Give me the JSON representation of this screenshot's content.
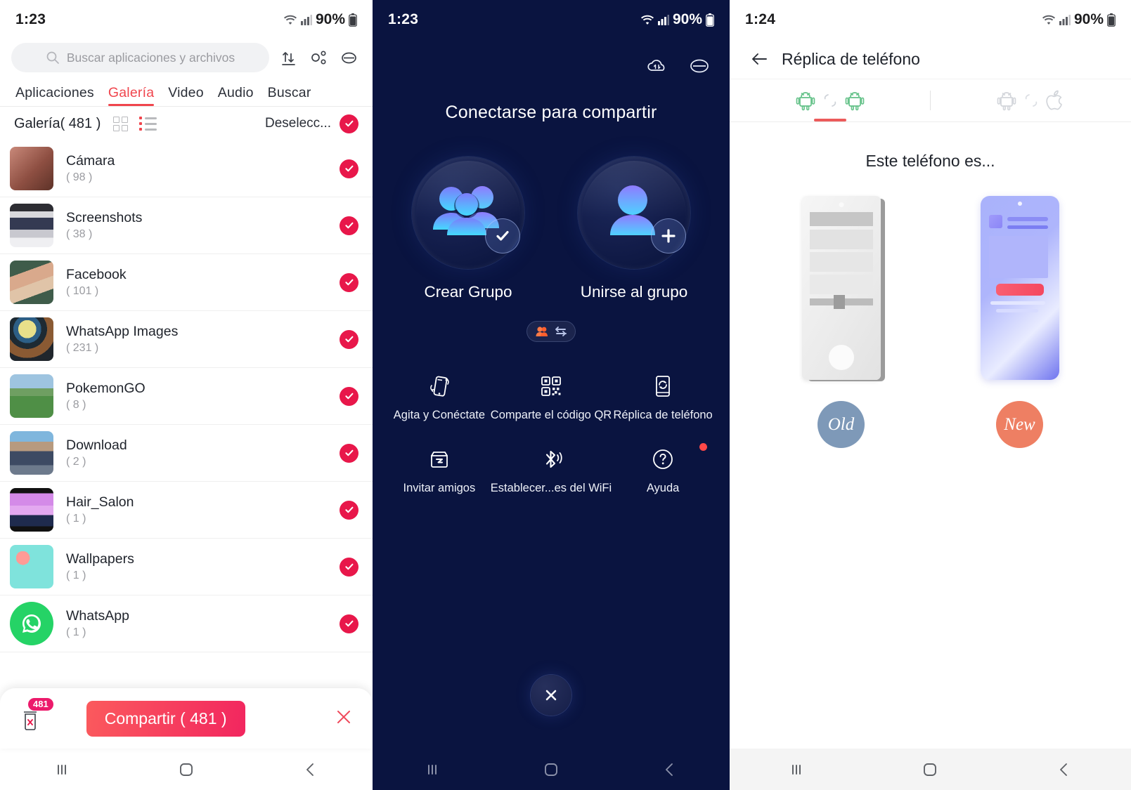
{
  "panel_file_picker": {
    "status_bar": {
      "time": "1:23",
      "battery": "90%",
      "wifi_icon": "wifi-icon",
      "signal_icon": "signal-bars-icon",
      "battery_icon": "battery-icon"
    },
    "search": {
      "placeholder": "Buscar aplicaciones y archivos",
      "icon": "search-icon"
    },
    "toolbar_icons": [
      {
        "name": "transfer-icon"
      },
      {
        "name": "share-nodes-icon"
      },
      {
        "name": "menu-icon"
      }
    ],
    "tabs": [
      {
        "label": "Aplicaciones",
        "active": false
      },
      {
        "label": "Galería",
        "active": true
      },
      {
        "label": "Video",
        "active": false
      },
      {
        "label": "Audio",
        "active": false
      },
      {
        "label": "Buscar",
        "active": false
      }
    ],
    "subheader": {
      "title": "Galería( 481 )",
      "grid_icon": "grid-view-icon",
      "list_icon": "list-view-icon",
      "deselect_label": "Deselecc...",
      "check_icon": "check-circle-icon"
    },
    "files": [
      {
        "name": "Cámara",
        "count": "( 98 )",
        "selected": true,
        "thumb": "camera-thumb"
      },
      {
        "name": "Screenshots",
        "count": "( 38 )",
        "selected": true,
        "thumb": "screenshots-thumb"
      },
      {
        "name": "Facebook",
        "count": "( 101 )",
        "selected": true,
        "thumb": "facebook-thumb"
      },
      {
        "name": "WhatsApp Images",
        "count": "( 231 )",
        "selected": true,
        "thumb": "whatsapp-images-thumb"
      },
      {
        "name": "PokemonGO",
        "count": "( 8 )",
        "selected": true,
        "thumb": "pokemongo-thumb"
      },
      {
        "name": "Download",
        "count": "( 2 )",
        "selected": true,
        "thumb": "download-thumb"
      },
      {
        "name": "Hair_Salon",
        "count": "( 1 )",
        "selected": true,
        "thumb": "hairsalon-thumb"
      },
      {
        "name": "Wallpapers",
        "count": "( 1 )",
        "selected": true,
        "thumb": "wallpapers-thumb"
      },
      {
        "name": "WhatsApp",
        "count": "( 1 )",
        "selected": true,
        "thumb": "whatsapp-thumb"
      }
    ],
    "bottom_bar": {
      "trash_icon": "trash-delete-icon",
      "trash_badge": "481",
      "share_label": "Compartir ( 481 )",
      "close_icon": "close-x-icon"
    },
    "nav_bar": {
      "recents_icon": "recents-icon",
      "home_icon": "home-icon",
      "back_icon": "back-icon"
    }
  },
  "panel_share_hub": {
    "status_bar": {
      "time": "1:23",
      "battery": "90%"
    },
    "top_icons": [
      {
        "name": "cloud-sync-icon"
      },
      {
        "name": "menu-icon"
      }
    ],
    "title": "Conectarse para compartir",
    "primary_actions": [
      {
        "label": "Crear Grupo",
        "icon": "group-users-icon",
        "badge": "check-badge-icon"
      },
      {
        "label": "Unirse al grupo",
        "icon": "single-user-icon",
        "badge": "plus-badge-icon"
      }
    ],
    "toggle_pill": {
      "left_icon": "people-icon",
      "right_icon": "swap-arrows-icon"
    },
    "actions": [
      {
        "label": "Agita y Conéctate",
        "icon": "shake-phone-icon",
        "has_dot": false
      },
      {
        "label": "Comparte el código QR",
        "icon": "qr-code-icon",
        "has_dot": false
      },
      {
        "label": "Réplica de teléfono",
        "icon": "phone-clone-icon",
        "has_dot": false
      },
      {
        "label": "Invitar amigos",
        "icon": "invite-box-icon",
        "has_dot": false
      },
      {
        "label": "Establecer...es del WiFi",
        "icon": "bluetooth-icon",
        "has_dot": false
      },
      {
        "label": "Ayuda",
        "icon": "help-question-icon",
        "has_dot": true
      }
    ],
    "close_button": {
      "icon": "close-x-icon"
    },
    "nav_bar": {
      "recents_icon": "recents-icon",
      "home_icon": "home-icon",
      "back_icon": "back-icon"
    }
  },
  "panel_phone_clone": {
    "status_bar": {
      "time": "1:24",
      "battery": "90%"
    },
    "app_bar": {
      "back_icon": "back-arrow-icon",
      "title": "Réplica de teléfono"
    },
    "tabs": [
      {
        "name": "android-to-android-tab",
        "icons": [
          "android-icon",
          "arrows-icon",
          "android-icon"
        ],
        "active": true
      },
      {
        "name": "android-to-ios-tab",
        "icons": [
          "android-icon",
          "arrows-icon",
          "apple-icon"
        ],
        "active": false
      }
    ],
    "subtitle": "Este teléfono es...",
    "choices": [
      {
        "badge": "Old",
        "badge_color": "#7e99b8",
        "phone": "old-phone-illustration"
      },
      {
        "badge": "New",
        "badge_color": "#ee7f63",
        "phone": "new-phone-illustration"
      }
    ],
    "nav_bar": {
      "recents_icon": "recents-icon",
      "home_icon": "home-icon",
      "back_icon": "back-icon"
    }
  },
  "colors": {
    "accent_red": "#f0454d",
    "check_red": "#e8174a",
    "share_gradient_start": "#fb5a5d",
    "share_gradient_end": "#f2265f",
    "navy_bg": "#0a1440",
    "android_green": "#62c187",
    "old_badge": "#7e99b8",
    "new_badge": "#ee7f63"
  }
}
